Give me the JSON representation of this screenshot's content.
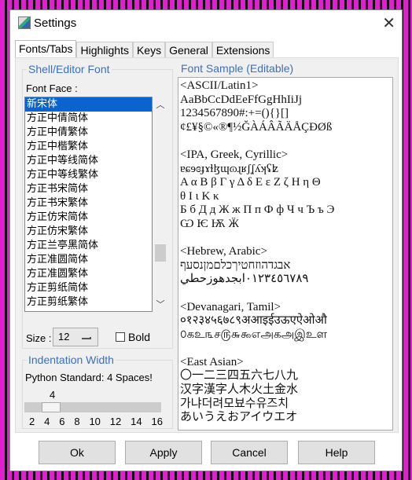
{
  "window": {
    "title": "Settings",
    "close": "✕"
  },
  "tabs": [
    "Fonts/Tabs",
    "Highlights",
    "Keys",
    "General",
    "Extensions"
  ],
  "font_group": {
    "legend": "Shell/Editor Font",
    "face_label": "Font Face :",
    "fonts": [
      "新宋体",
      "方正中倩简体",
      "方正中倩繁体",
      "方正中楷繁体",
      "方正中等线简体",
      "方正中等线繁体",
      "方正书宋简体",
      "方正书宋繁体",
      "方正仿宋简体",
      "方正仿宋繁体",
      "方正兰亭黑简体",
      "方正准圆简体",
      "方正准圆繁体",
      "方正剪纸简体",
      "方正剪纸繁体"
    ],
    "selected": "新宋体",
    "size_label": "Size :",
    "size_value": "12",
    "bold_label": "Bold",
    "bold_checked": false
  },
  "indent_group": {
    "legend": "Indentation Width",
    "note": "Python Standard: 4 Spaces!",
    "value": "4",
    "ticks": [
      "2",
      "4",
      "6",
      "8",
      "10",
      "12",
      "14",
      "16"
    ]
  },
  "sample_group": {
    "legend": "Font Sample (Editable)",
    "text": "<ASCII/Latin1>\nAaBbCcDdEeFfGgHhIiJj\n1234567890#:+=(){}[]\n¢£¥§©«®¶½ĞÀÁÂÃÄÅÇÐØß\n\n<IPA, Greek, Cyrillic>\nɐɕɘɞɟɤɫɮɰɷɻʁʃʆʎʞʢʫ\nΑ α Β β Γ γ Δ δ Ε ε Ζ ζ Η η Θ\nθ Ι ι Κ κ\nБ б Д д Ж ж П п Ф ф Ч ч Ъ ъ Э\nѠ Ѥ Ѭ Ӝ\n\n<Hebrew, Arabic>\nאבגדהוזחטיךכלםמןנסעף\n٠١٢٣٤٥٦٧٨٩ابجدهوزحطي\n\n<Devanagari, Tamil>\n०१२३४५६७८९अआइईउऊएऐओऔ\n௦கஉ௩ச௫௬௯எஅகஅஇஉள\n\n<East Asian>\n〇一二三四五六七八九\n汉字漢字人木火土金水\n가냐더려모뵤수유즈치\nあいうえおアイウエオ"
  },
  "buttons": {
    "ok": "Ok",
    "apply": "Apply",
    "cancel": "Cancel",
    "help": "Help"
  }
}
